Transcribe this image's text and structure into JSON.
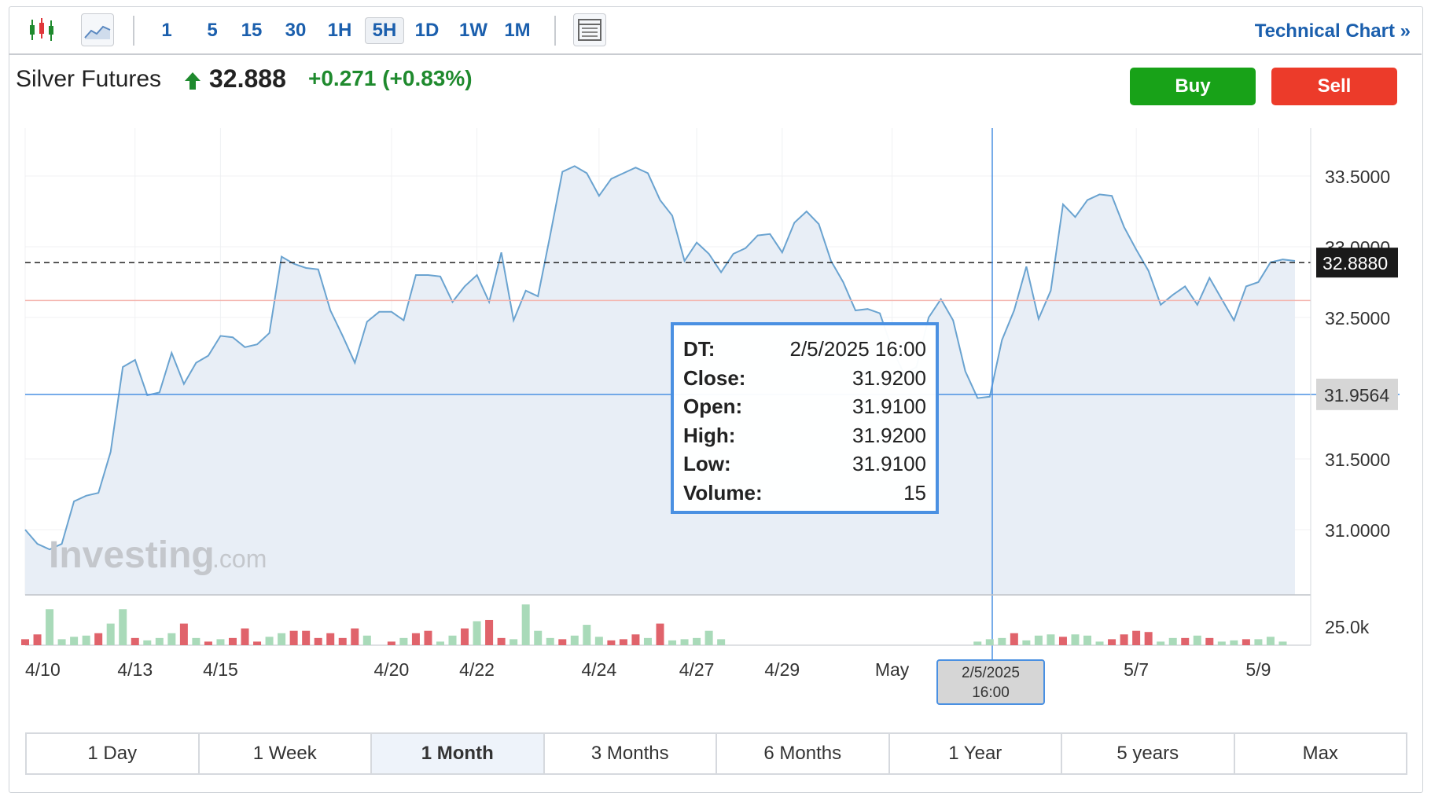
{
  "toolbar": {
    "intervals": [
      "1",
      "5",
      "15",
      "30",
      "1H",
      "5H",
      "1D",
      "1W",
      "1M"
    ],
    "active_interval": "5H",
    "technical_chart_label": "Technical Chart »"
  },
  "quote": {
    "name": "Silver Futures",
    "price": "32.888",
    "change": "+0.271 (+0.83%)",
    "buy_label": "Buy",
    "sell_label": "Sell"
  },
  "watermark": {
    "brand": "Investing",
    "suffix": ".com"
  },
  "chart_data": {
    "type": "area",
    "y_ticks": [
      "33.5000",
      "33.0000",
      "32.5000",
      "31.5000",
      "31.0000"
    ],
    "y_tick_values": [
      33.5,
      33.0,
      32.5,
      31.5,
      31.0
    ],
    "ylim": [
      30.8,
      33.7
    ],
    "last_price_label": "32.8880",
    "last_price": 32.888,
    "crosshair_price_label": "31.9564",
    "crosshair_price": 31.9564,
    "reference_price": 32.62,
    "x_labels": [
      "4/10",
      "4/13",
      "4/15",
      "4/20",
      "4/22",
      "4/24",
      "4/27",
      "4/29",
      "May",
      "5/7",
      "5/9"
    ],
    "x_label_index": [
      0,
      9,
      16,
      30,
      37,
      47,
      55,
      62,
      71,
      91,
      101
    ],
    "volume_axis_label": "25.0k",
    "volume_max": 40000,
    "series": [
      {
        "values": [
          31.0,
          30.9,
          30.86,
          30.9,
          31.2,
          31.24,
          31.26,
          31.55,
          32.15,
          32.2,
          31.95,
          31.97,
          32.25,
          32.03,
          32.18,
          32.23,
          32.37,
          32.36,
          32.29,
          32.31,
          32.39,
          32.93,
          32.88,
          32.85,
          32.84,
          32.55,
          32.37,
          32.18,
          32.47,
          32.54,
          32.54,
          32.48,
          32.8,
          32.8,
          32.79,
          32.61,
          32.72,
          32.8,
          32.61,
          32.96,
          32.48,
          32.69,
          32.65,
          33.08,
          33.53,
          33.57,
          33.52,
          33.36,
          33.48,
          33.52,
          33.56,
          33.52,
          33.33,
          33.22,
          32.9,
          33.03,
          32.95,
          32.82,
          32.95,
          32.99,
          33.08,
          33.09,
          32.96,
          33.17,
          33.25,
          33.16,
          32.9,
          32.75,
          32.55,
          32.56,
          32.53,
          32.28,
          32.1,
          32.15,
          32.5,
          32.63,
          32.48,
          32.12,
          31.93,
          31.94,
          32.34,
          32.55,
          32.86,
          32.49,
          32.69,
          33.3,
          33.21,
          33.33,
          33.37,
          33.36,
          33.14,
          32.98,
          32.83,
          32.59,
          32.66,
          32.72,
          32.59,
          32.78,
          32.63,
          32.48,
          32.72,
          32.75,
          32.89,
          32.91,
          32.9
        ]
      }
    ],
    "volume": [
      {
        "v": 5000,
        "up": false
      },
      {
        "v": 9000,
        "up": false
      },
      {
        "v": 30000,
        "up": true
      },
      {
        "v": 5000,
        "up": true
      },
      {
        "v": 7000,
        "up": true
      },
      {
        "v": 8000,
        "up": true
      },
      {
        "v": 10000,
        "up": false
      },
      {
        "v": 18000,
        "up": true
      },
      {
        "v": 30000,
        "up": true
      },
      {
        "v": 6000,
        "up": false
      },
      {
        "v": 4000,
        "up": true
      },
      {
        "v": 6000,
        "up": true
      },
      {
        "v": 10000,
        "up": true
      },
      {
        "v": 18000,
        "up": false
      },
      {
        "v": 6000,
        "up": true
      },
      {
        "v": 3000,
        "up": false
      },
      {
        "v": 5000,
        "up": true
      },
      {
        "v": 6000,
        "up": false
      },
      {
        "v": 14000,
        "up": false
      },
      {
        "v": 3000,
        "up": false
      },
      {
        "v": 7000,
        "up": true
      },
      {
        "v": 10000,
        "up": true
      },
      {
        "v": 12000,
        "up": false
      },
      {
        "v": 12000,
        "up": false
      },
      {
        "v": 6000,
        "up": false
      },
      {
        "v": 10000,
        "up": false
      },
      {
        "v": 6000,
        "up": false
      },
      {
        "v": 14000,
        "up": false
      },
      {
        "v": 8000,
        "up": true
      },
      {
        "v": 0,
        "up": true
      },
      {
        "v": 3000,
        "up": false
      },
      {
        "v": 6000,
        "up": true
      },
      {
        "v": 10000,
        "up": false
      },
      {
        "v": 12000,
        "up": false
      },
      {
        "v": 3000,
        "up": true
      },
      {
        "v": 8000,
        "up": true
      },
      {
        "v": 14000,
        "up": false
      },
      {
        "v": 20000,
        "up": true
      },
      {
        "v": 21000,
        "up": false
      },
      {
        "v": 6000,
        "up": false
      },
      {
        "v": 5000,
        "up": true
      },
      {
        "v": 34000,
        "up": true
      },
      {
        "v": 12000,
        "up": true
      },
      {
        "v": 6000,
        "up": true
      },
      {
        "v": 5000,
        "up": false
      },
      {
        "v": 8000,
        "up": true
      },
      {
        "v": 17000,
        "up": true
      },
      {
        "v": 7000,
        "up": true
      },
      {
        "v": 4000,
        "up": false
      },
      {
        "v": 5000,
        "up": false
      },
      {
        "v": 9000,
        "up": false
      },
      {
        "v": 6000,
        "up": true
      },
      {
        "v": 18000,
        "up": false
      },
      {
        "v": 4000,
        "up": true
      },
      {
        "v": 5000,
        "up": true
      },
      {
        "v": 6000,
        "up": true
      },
      {
        "v": 12000,
        "up": true
      },
      {
        "v": 5000,
        "up": true
      },
      {
        "v": 0,
        "up": true
      },
      {
        "v": 0,
        "up": true
      },
      {
        "v": 0,
        "up": true
      },
      {
        "v": 0,
        "up": true
      },
      {
        "v": 0,
        "up": true
      },
      {
        "v": 0,
        "up": true
      },
      {
        "v": 0,
        "up": true
      },
      {
        "v": 0,
        "up": true
      },
      {
        "v": 0,
        "up": true
      },
      {
        "v": 0,
        "up": true
      },
      {
        "v": 0,
        "up": true
      },
      {
        "v": 0,
        "up": true
      },
      {
        "v": 0,
        "up": true
      },
      {
        "v": 0,
        "up": true
      },
      {
        "v": 0,
        "up": true
      },
      {
        "v": 0,
        "up": true
      },
      {
        "v": 0,
        "up": true
      },
      {
        "v": 0,
        "up": true
      },
      {
        "v": 0,
        "up": true
      },
      {
        "v": 0,
        "up": true
      },
      {
        "v": 3000,
        "up": true
      },
      {
        "v": 5000,
        "up": true
      },
      {
        "v": 6000,
        "up": true
      },
      {
        "v": 10000,
        "up": false
      },
      {
        "v": 4000,
        "up": true
      },
      {
        "v": 8000,
        "up": true
      },
      {
        "v": 9000,
        "up": true
      },
      {
        "v": 7000,
        "up": false
      },
      {
        "v": 9000,
        "up": true
      },
      {
        "v": 8000,
        "up": true
      },
      {
        "v": 3000,
        "up": true
      },
      {
        "v": 5000,
        "up": false
      },
      {
        "v": 9000,
        "up": false
      },
      {
        "v": 12000,
        "up": false
      },
      {
        "v": 11000,
        "up": false
      },
      {
        "v": 3000,
        "up": true
      },
      {
        "v": 6000,
        "up": true
      },
      {
        "v": 6000,
        "up": false
      },
      {
        "v": 8000,
        "up": true
      },
      {
        "v": 6000,
        "up": false
      },
      {
        "v": 3000,
        "up": true
      },
      {
        "v": 4000,
        "up": true
      },
      {
        "v": 5000,
        "up": false
      },
      {
        "v": 5000,
        "up": true
      },
      {
        "v": 7000,
        "up": true
      },
      {
        "v": 3000,
        "up": true
      }
    ],
    "colors": {
      "line": "#6aa3d0",
      "fill": "#e8eef6",
      "volume_up": "#a9dab9",
      "volume_down": "#e0636b",
      "crosshair": "#4a90e2",
      "reference_line": "#f4b5ae"
    }
  },
  "tooltip": {
    "rows": [
      {
        "key": "DT:",
        "value": "2/5/2025 16:00"
      },
      {
        "key": "Close:",
        "value": "31.9200"
      },
      {
        "key": "Open:",
        "value": "31.9100"
      },
      {
        "key": "High:",
        "value": "31.9200"
      },
      {
        "key": "Low:",
        "value": "31.9100"
      },
      {
        "key": "Volume:",
        "value": "15"
      }
    ]
  },
  "crosshair": {
    "date_line1": "2/5/2025",
    "date_line2": "16:00"
  },
  "ranges": [
    "1 Day",
    "1 Week",
    "1 Month",
    "3 Months",
    "6 Months",
    "1 Year",
    "5 years",
    "Max"
  ],
  "active_range": "1 Month"
}
